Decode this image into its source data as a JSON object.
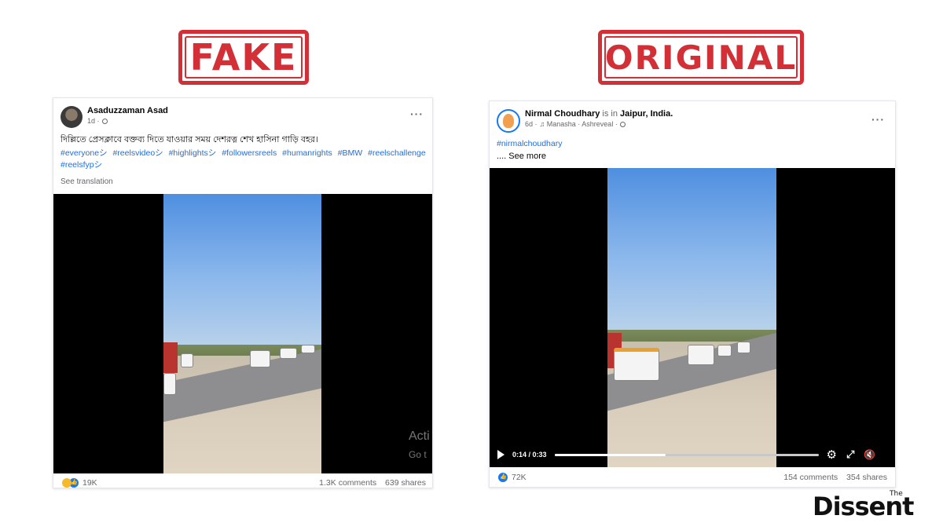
{
  "labels": {
    "fake": "FAKE",
    "original": "ORIGINAL"
  },
  "fake_post": {
    "author": "Asaduzzaman Asad",
    "time": "1d ·",
    "caption": "দিল্লিতে প্রেসক্লাবে বক্তব্য দিতে যাওয়ার সময় দেশরত্ন শেখ হাসিনা গাড়ি বহর।",
    "hashtags": [
      "#everyoneシ",
      "#reelsvideoシ",
      "#highlightsシ",
      "#followersreels",
      "#humanrights",
      "#BMW",
      "#reelschallenge",
      "#reelsfypシ"
    ],
    "see_translation": "See translation",
    "watermark": "Acti",
    "watermark2": "Go t",
    "reactions_count": "19K",
    "comments": "1.3K comments",
    "shares": "639 shares"
  },
  "original_post": {
    "author": "Nirmal Choudhary",
    "is_in": "is in",
    "location": "Jaipur, India.",
    "time": "6d ·",
    "audio": "♫ Manasha · Ashreveal ·",
    "hashtag": "#nirmalchoudhary",
    "see_more": ".... See more",
    "video_time": "0:14 / 0:33",
    "video_progress": 0.42,
    "reactions_count": "72K",
    "comments": "154 comments",
    "shares": "354 shares"
  },
  "brand": {
    "the": "The",
    "name": "Dissent"
  },
  "colors": {
    "stamp_red": "#d32f36",
    "link_blue": "#216fdb",
    "fb_blue": "#1877f2"
  },
  "icons": [
    "more-options-icon",
    "globe-icon",
    "play-icon",
    "gear-icon",
    "fullscreen-icon",
    "mute-icon",
    "like-icon",
    "haha-icon"
  ]
}
